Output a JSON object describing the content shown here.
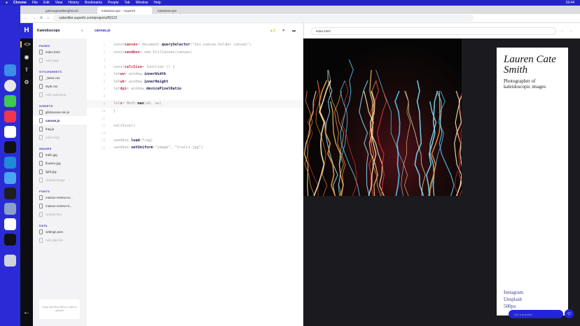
{
  "menubar": {
    "items": [
      "Chrome",
      "File",
      "Edit",
      "View",
      "History",
      "Bookmarks",
      "People",
      "Tab",
      "Window",
      "Help"
    ],
    "clock": "19:44"
  },
  "browser": {
    "tabs": [
      {
        "label": "patricegeraldwrightCarl..."
      },
      {
        "label": "Kaleidoscope – SuperHi"
      },
      {
        "label": "Kaleidoscope"
      }
    ],
    "url": "subeditor.superhi.com/projects/89122"
  },
  "sidebar": {
    "project": "Kaleidoscope",
    "sections": [
      {
        "title": "PAGES",
        "files": [
          "index.html"
        ],
        "add": "Add page"
      },
      {
        "title": "STYLESHEETS",
        "files": [
          "_base.css",
          "style.css"
        ],
        "add": "Add stylesheet"
      },
      {
        "title": "SCRIPTS",
        "files": [
          "glslcanvas.min.js",
          "canvas.js",
          "frag.js"
        ],
        "add": "Add script"
      },
      {
        "title": "IMAGES",
        "files": [
          "trails.jpg",
          "flowers.jpg",
          "light.jpg"
        ],
        "add": "Upload image"
      },
      {
        "title": "FONTS",
        "files": [
          "masius-review-ex...",
          "masius-review-re..."
        ],
        "add": "Upload font"
      },
      {
        "title": "DATA",
        "files": [
          "settings.json"
        ],
        "add": "Add data file"
      }
    ],
    "drop_text": "Drag and drop files or click to upload"
  },
  "editor": {
    "filename": "canvas.js",
    "warnings": "1",
    "lines": [
      [
        "const ",
        "canvas",
        " = document.",
        "querySelector",
        "(\"div.canvas-holder canvas\")"
      ],
      [
        "const ",
        "sandbox",
        " = new GlslCanvas(canvas)",
        "",
        ""
      ],
      [
        "",
        "",
        "",
        "",
        ""
      ],
      [
        "const ",
        "calcSize",
        " = function () {",
        "",
        ""
      ],
      [
        "  let ",
        "ww",
        " = window.",
        "innerWidth",
        ""
      ],
      [
        "  let ",
        "wh",
        " = window.",
        "innerHeight",
        ""
      ],
      [
        "  let ",
        "dpi",
        " = window.",
        "devicePixelRatio",
        ""
      ],
      [
        "",
        "",
        "",
        "",
        ""
      ],
      [
        "  let ",
        "s",
        " = Math.",
        "max",
        "(wh, ww)"
      ],
      [
        "}",
        "",
        "",
        "",
        ""
      ],
      [
        "",
        "",
        "",
        "",
        ""
      ],
      [
        "calcSize()",
        "",
        "",
        "",
        ""
      ],
      [
        "",
        "",
        "",
        "",
        ""
      ],
      [
        "sandbox.",
        "",
        "",
        "load",
        "(frag)"
      ],
      [
        "sandbox.",
        "",
        "",
        "setUniform",
        "(\"image\", \"trails.jpg\")"
      ]
    ]
  },
  "preview": {
    "url": "index.html",
    "name": "Lauren Cate Smith",
    "tagline": "Photographer of kaleidoscopic images",
    "links": [
      "Instagram",
      "Unsplash",
      "500px"
    ],
    "ask_placeholder": "Ask a question"
  }
}
